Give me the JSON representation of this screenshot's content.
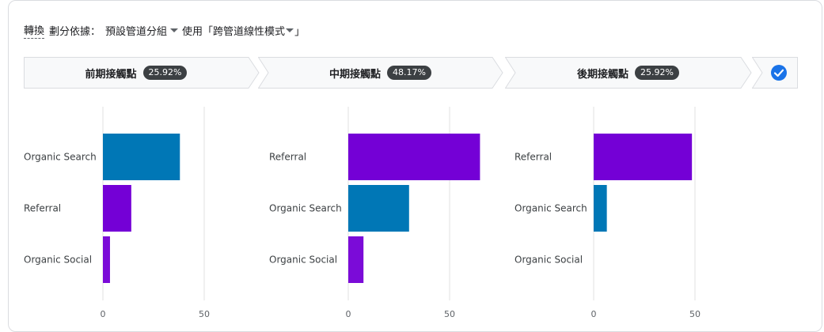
{
  "header": {
    "conversions_label": "轉換",
    "breakdown_label": "劃分依據：",
    "breakdown_value": "預設管道分組",
    "mode_label": "使用「跨管道線性模式",
    "mode_suffix": "」"
  },
  "stages": [
    {
      "label": "前期接觸點",
      "percent": "25.92%"
    },
    {
      "label": "中期接觸點",
      "percent": "48.17%"
    },
    {
      "label": "後期接觸點",
      "percent": "25.92%"
    }
  ],
  "colors": {
    "Organic Search": "#0077b6",
    "Referral": "#7400d6",
    "Organic Social": "#7b0bd8",
    "check": "#1a73e8"
  },
  "chart_data": [
    {
      "type": "bar",
      "orientation": "horizontal",
      "categories": [
        "Organic Search",
        "Referral",
        "Organic Social"
      ],
      "values": [
        38,
        14,
        3.5
      ],
      "xlim": [
        0,
        50
      ],
      "xticks": [
        "0",
        "50"
      ],
      "grid": true
    },
    {
      "type": "bar",
      "orientation": "horizontal",
      "categories": [
        "Referral",
        "Organic Search",
        "Organic Social"
      ],
      "values": [
        65,
        30,
        7.5
      ],
      "xlim": [
        0,
        50
      ],
      "xticks": [
        "0",
        "50"
      ],
      "grid": true
    },
    {
      "type": "bar",
      "orientation": "horizontal",
      "categories": [
        "Referral",
        "Organic Search",
        "Organic Social"
      ],
      "values": [
        48.5,
        6.5,
        0
      ],
      "xlim": [
        0,
        50
      ],
      "xticks": [
        "0",
        "50"
      ],
      "grid": true
    }
  ]
}
